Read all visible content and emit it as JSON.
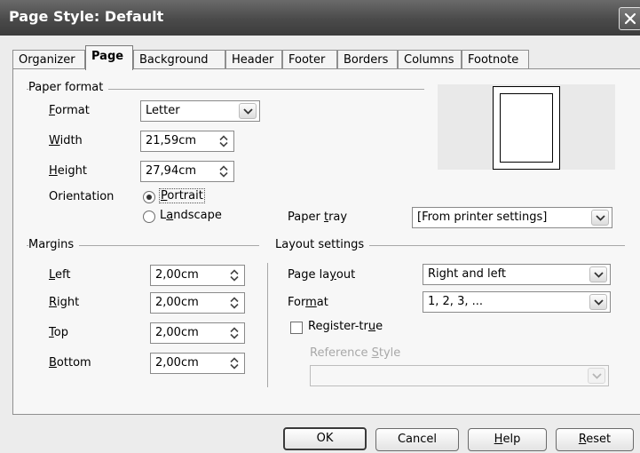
{
  "window": {
    "title": "Page Style: Default"
  },
  "tabs": [
    {
      "label": "Organizer"
    },
    {
      "label": "Page",
      "active": true
    },
    {
      "label": "Background"
    },
    {
      "label": "Header"
    },
    {
      "label": "Footer"
    },
    {
      "label": "Borders"
    },
    {
      "label": "Columns"
    },
    {
      "label": "Footnote"
    }
  ],
  "paper_format": {
    "title": "Paper format",
    "format": {
      "label_u": "F",
      "label_rest": "ormat",
      "value": "Letter"
    },
    "width": {
      "label_u": "W",
      "label_rest": "idth",
      "value": "21,59cm"
    },
    "height": {
      "label_u": "H",
      "label_rest": "eight",
      "value": "27,94cm"
    },
    "orientation": {
      "label": "Orientation",
      "portrait": {
        "label_u": "P",
        "label_rest": "ortrait",
        "selected": true
      },
      "landscape": {
        "label_pre": "L",
        "label_u": "a",
        "label_rest": "ndscape",
        "selected": false
      }
    },
    "paper_tray": {
      "label_pre": "Paper ",
      "label_u": "t",
      "label_rest": "ray",
      "value": "[From printer settings]"
    }
  },
  "margins": {
    "title": "Margins",
    "left": {
      "label_u": "L",
      "label_rest": "eft",
      "value": "2,00cm"
    },
    "right": {
      "label_u": "R",
      "label_rest": "ight",
      "value": "2,00cm"
    },
    "top": {
      "label_u": "T",
      "label_rest": "op",
      "value": "2,00cm"
    },
    "bottom": {
      "label_u": "B",
      "label_rest": "ottom",
      "value": "2,00cm"
    }
  },
  "layout_settings": {
    "title": "Layout settings",
    "page_layout": {
      "label_pre": "Page la",
      "label_u": "y",
      "label_rest": "out",
      "value": "Right and left"
    },
    "format": {
      "label_pre": "For",
      "label_u": "m",
      "label_rest": "at",
      "value": "1, 2, 3, ..."
    },
    "register_true": {
      "label_pre": "Register-tr",
      "label_u": "u",
      "label_rest": "e",
      "checked": false
    },
    "reference_style": {
      "label_pre": "Reference ",
      "label_u": "S",
      "label_rest": "tyle",
      "value": ""
    }
  },
  "buttons": {
    "ok": "OK",
    "cancel": "Cancel",
    "help_u": "H",
    "help_rest": "elp",
    "reset_u": "R",
    "reset_rest": "eset"
  }
}
